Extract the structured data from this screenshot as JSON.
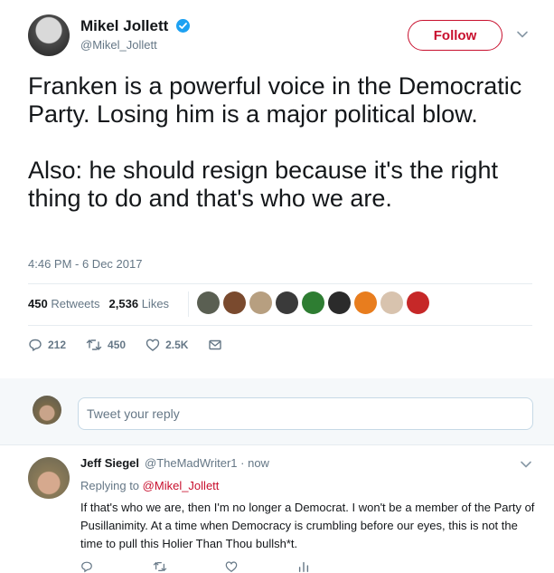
{
  "tweet": {
    "author_name": "Mikel Jollett",
    "handle": "@Mikel_Jollett",
    "follow_label": "Follow",
    "text": "Franken is a powerful voice in the Democratic Party. Losing him is a major political blow.\n\nAlso: he should resign because it's the right thing to do and that's who we are.",
    "timestamp": "4:46 PM - 6 Dec 2017",
    "retweets_count": "450",
    "retweets_label": "Retweets",
    "likes_count": "2,536",
    "likes_label": "Likes",
    "liker_colors": [
      "#5a5f52",
      "#7a4a2e",
      "#b79f80",
      "#3a3a3a",
      "#2e7d32",
      "#2b2b2b",
      "#e87d1e",
      "#d8c3ae",
      "#c62828"
    ],
    "actions": {
      "replies": "212",
      "retweets": "450",
      "likes": "2.5K"
    }
  },
  "reply_box": {
    "placeholder": "Tweet your reply"
  },
  "reply": {
    "author_name": "Jeff Siegel",
    "handle_time": "@TheMadWriter1 · now",
    "replying_prefix": "Replying to",
    "replying_to": "@Mikel_Jollett",
    "text": "If that's who we are, then I'm no longer a Democrat. I won't be a member of the Party of Pusillanimity. At a time when Democracy is crumbling before our eyes, this is not the time to pull this Holier Than Thou bullsh*t."
  },
  "colors": {
    "accent": "#c8102e",
    "verified": "#1da1f2",
    "muted_text": "#657786",
    "border": "#e6ecf0"
  },
  "icons": [
    "verified-badge-icon",
    "chevron-down-icon",
    "reply-icon",
    "retweet-icon",
    "like-icon",
    "direct-message-icon"
  ]
}
